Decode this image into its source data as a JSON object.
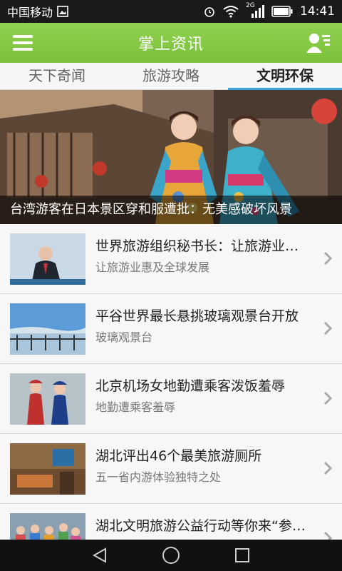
{
  "status": {
    "carrier": "中国移动",
    "network": "2G",
    "time": "14:41"
  },
  "header": {
    "title": "掌上资讯"
  },
  "tabs": [
    {
      "label": "天下奇闻"
    },
    {
      "label": "旅游攻略"
    },
    {
      "label": "文明环保"
    }
  ],
  "banner": {
    "caption": "台湾游客在日本景区穿和服遭批：无美感破坏风景"
  },
  "articles": [
    {
      "title": "世界旅游组织秘书长：让旅游业惠及全球发展",
      "subtitle": "让旅游业惠及全球发展"
    },
    {
      "title": "平谷世界最长悬挑玻璃观景台开放",
      "subtitle": "玻璃观景台"
    },
    {
      "title": "北京机场女地勤遭乘客泼饭羞辱",
      "subtitle": "地勤遭乘客羞辱"
    },
    {
      "title": "湖北评出46个最美旅游厕所",
      "subtitle": "五一省内游体验独特之处"
    },
    {
      "title": "湖北文明旅游公益行动等你来“参与”",
      "subtitle": ""
    }
  ],
  "colors": {
    "appbar": "#7bc13b",
    "tab_indicator": "#3aa0d8"
  }
}
